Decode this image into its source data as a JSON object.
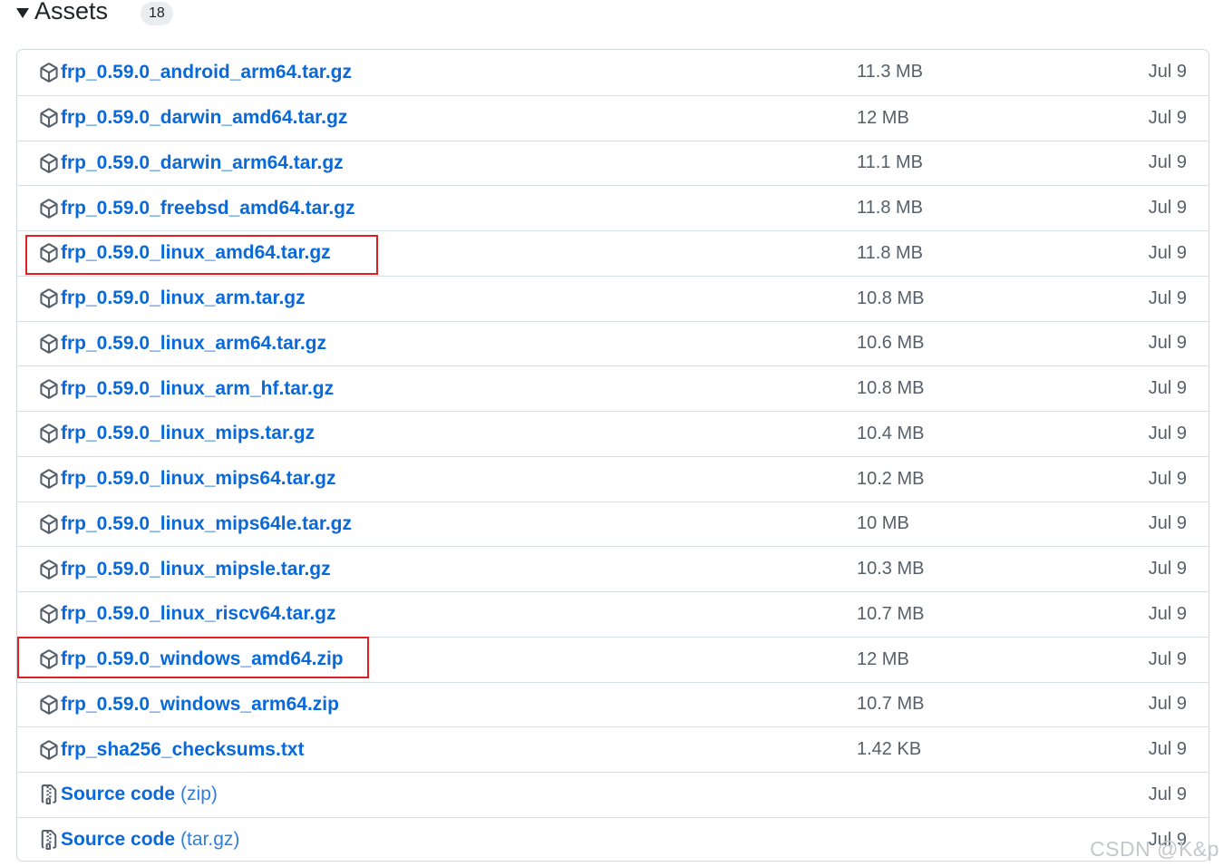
{
  "header": {
    "title": "Assets",
    "count": "18"
  },
  "assets": [
    {
      "name": "frp_0.59.0_android_arm64.tar.gz",
      "suffix": "",
      "size": "11.3 MB",
      "date": "Jul 9",
      "icon": "package-icon"
    },
    {
      "name": "frp_0.59.0_darwin_amd64.tar.gz",
      "suffix": "",
      "size": "12 MB",
      "date": "Jul 9",
      "icon": "package-icon"
    },
    {
      "name": "frp_0.59.0_darwin_arm64.tar.gz",
      "suffix": "",
      "size": "11.1 MB",
      "date": "Jul 9",
      "icon": "package-icon"
    },
    {
      "name": "frp_0.59.0_freebsd_amd64.tar.gz",
      "suffix": "",
      "size": "11.8 MB",
      "date": "Jul 9",
      "icon": "package-icon"
    },
    {
      "name": "frp_0.59.0_linux_amd64.tar.gz",
      "suffix": "",
      "size": "11.8 MB",
      "date": "Jul 9",
      "icon": "package-icon"
    },
    {
      "name": "frp_0.59.0_linux_arm.tar.gz",
      "suffix": "",
      "size": "10.8 MB",
      "date": "Jul 9",
      "icon": "package-icon"
    },
    {
      "name": "frp_0.59.0_linux_arm64.tar.gz",
      "suffix": "",
      "size": "10.6 MB",
      "date": "Jul 9",
      "icon": "package-icon"
    },
    {
      "name": "frp_0.59.0_linux_arm_hf.tar.gz",
      "suffix": "",
      "size": "10.8 MB",
      "date": "Jul 9",
      "icon": "package-icon"
    },
    {
      "name": "frp_0.59.0_linux_mips.tar.gz",
      "suffix": "",
      "size": "10.4 MB",
      "date": "Jul 9",
      "icon": "package-icon"
    },
    {
      "name": "frp_0.59.0_linux_mips64.tar.gz",
      "suffix": "",
      "size": "10.2 MB",
      "date": "Jul 9",
      "icon": "package-icon"
    },
    {
      "name": "frp_0.59.0_linux_mips64le.tar.gz",
      "suffix": "",
      "size": "10 MB",
      "date": "Jul 9",
      "icon": "package-icon"
    },
    {
      "name": "frp_0.59.0_linux_mipsle.tar.gz",
      "suffix": "",
      "size": "10.3 MB",
      "date": "Jul 9",
      "icon": "package-icon"
    },
    {
      "name": "frp_0.59.0_linux_riscv64.tar.gz",
      "suffix": "",
      "size": "10.7 MB",
      "date": "Jul 9",
      "icon": "package-icon"
    },
    {
      "name": "frp_0.59.0_windows_amd64.zip",
      "suffix": "",
      "size": "12 MB",
      "date": "Jul 9",
      "icon": "package-icon"
    },
    {
      "name": "frp_0.59.0_windows_arm64.zip",
      "suffix": "",
      "size": "10.7 MB",
      "date": "Jul 9",
      "icon": "package-icon"
    },
    {
      "name": "frp_sha256_checksums.txt",
      "suffix": "",
      "size": "1.42 KB",
      "date": "Jul 9",
      "icon": "package-icon"
    },
    {
      "name": "Source code",
      "suffix": "(zip)",
      "size": "",
      "date": "Jul 9",
      "icon": "file-zip-icon"
    },
    {
      "name": "Source code",
      "suffix": "(tar.gz)",
      "size": "",
      "date": "Jul 9",
      "icon": "file-zip-icon"
    }
  ],
  "watermark": "CSDN @K&p",
  "colors": {
    "link": "#0969da",
    "highlight": "#e02020",
    "muted": "#57606a"
  }
}
